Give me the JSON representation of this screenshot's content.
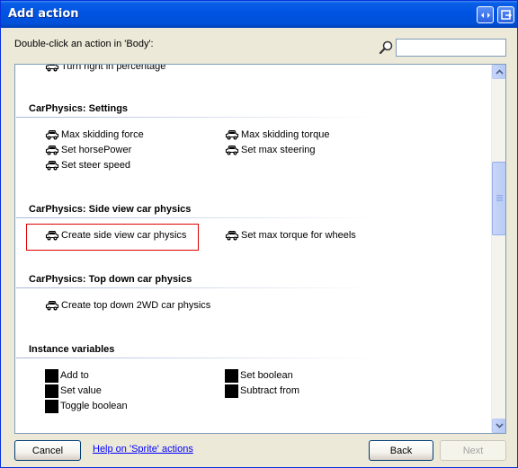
{
  "window": {
    "title": "Add action"
  },
  "prompt": "Double-click an action in 'Body':",
  "search": {
    "value": "",
    "placeholder": ""
  },
  "list": {
    "cut_off_item": "Turn right in percentage",
    "sections": [
      {
        "title": "CarPhysics: Settings",
        "items": [
          "Max skidding force",
          "Max skidding torque",
          "Set horsePower",
          "Set max steering",
          "Set steer speed"
        ]
      },
      {
        "title": "CarPhysics: Side view car physics",
        "items": [
          "Create side view car physics",
          "Set max torque for wheels"
        ]
      },
      {
        "title": "CarPhysics: Top down car physics",
        "items": [
          "Create top down 2WD car physics"
        ]
      },
      {
        "title": "Instance variables",
        "items": [
          "Add to",
          "Set boolean",
          "Set value",
          "Subtract from",
          "Toggle boolean"
        ]
      }
    ],
    "selected_item": "Create side view car physics"
  },
  "buttons": {
    "cancel": "Cancel",
    "help": "Help on 'Sprite' actions",
    "back": "Back",
    "next": "Next"
  },
  "icons": {
    "car": "car-icon",
    "variable": "variable-icon",
    "search": "search-icon",
    "restore": "restore-icon",
    "close": "close-icon"
  }
}
